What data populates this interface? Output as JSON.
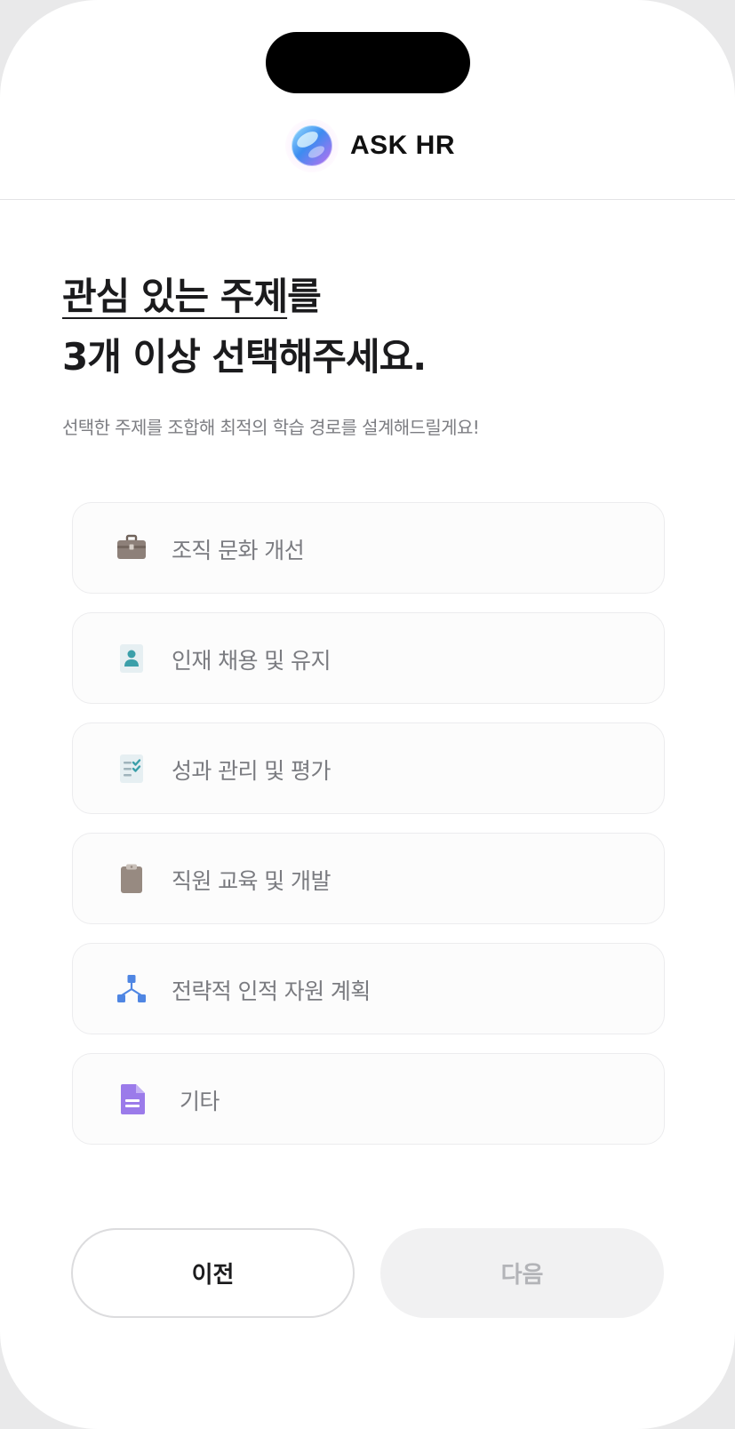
{
  "header": {
    "app_title": "ASK HR",
    "logo_icon": "orb-logo"
  },
  "headline": {
    "underlined": "관심 있는 주제",
    "suffix": "를",
    "line2": "3개 이상 선택해주세요."
  },
  "subtitle": "선택한 주제를 조합해 최적의 학습 경로를 설계해드릴게요!",
  "topics": [
    {
      "label": "조직 문화 개선",
      "icon": "briefcase-icon"
    },
    {
      "label": "인재 채용 및 유지",
      "icon": "person-badge-icon"
    },
    {
      "label": "성과 관리 및 평가",
      "icon": "checklist-icon"
    },
    {
      "label": "직원 교육 및 개발",
      "icon": "clipboard-icon"
    },
    {
      "label": "전략적 인적 자원 계획",
      "icon": "org-chart-icon"
    },
    {
      "label": "기타",
      "icon": "document-icon"
    }
  ],
  "buttons": {
    "prev": "이전",
    "next": "다음"
  },
  "colors": {
    "primary_text": "#1b1b1d",
    "muted_text": "#7a7b80",
    "disabled_button_bg": "#f1f1f2",
    "disabled_button_text": "#b3b4b8"
  }
}
